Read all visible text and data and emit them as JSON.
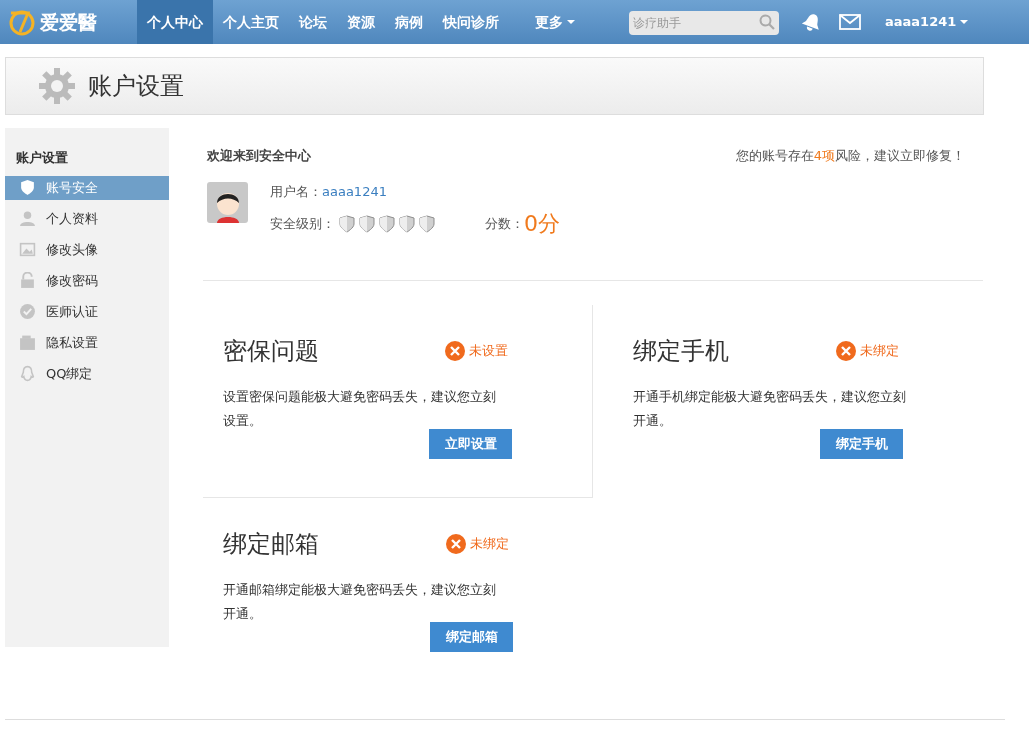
{
  "logo": {
    "text": "爱爱醫"
  },
  "nav": [
    {
      "label": "个人中心",
      "selected": true
    },
    {
      "label": "个人主页",
      "selected": false
    },
    {
      "label": "论坛",
      "selected": false
    },
    {
      "label": "资源",
      "selected": false
    },
    {
      "label": "病例",
      "selected": false
    },
    {
      "label": "快问诊所",
      "selected": false
    },
    {
      "label": "更多",
      "selected": false,
      "dropdown": true
    }
  ],
  "search": {
    "placeholder": "诊疗助手"
  },
  "user_menu": {
    "label": "aaaa1241"
  },
  "page_title": "账户设置",
  "sidebar": {
    "heading": "账户设置",
    "items": [
      {
        "label": "账号安全",
        "kind": "shield",
        "selected": true
      },
      {
        "label": "个人资料",
        "kind": "person",
        "selected": false
      },
      {
        "label": "修改头像",
        "kind": "image",
        "selected": false
      },
      {
        "label": "修改密码",
        "kind": "lock",
        "selected": false
      },
      {
        "label": "医师认证",
        "kind": "check",
        "selected": false
      },
      {
        "label": "隐私设置",
        "kind": "folder",
        "selected": false
      },
      {
        "label": "QQ绑定",
        "kind": "qq",
        "selected": false
      }
    ]
  },
  "welcome": "欢迎来到安全中心",
  "risk": {
    "prefix": "您的账号存在",
    "count": "4项",
    "suffix": "风险，建议立即修复！"
  },
  "username": {
    "label": "用户名：",
    "value": "aaaa1241"
  },
  "security_level": {
    "label": "安全级别："
  },
  "score": {
    "label": "分数：",
    "value": "0分"
  },
  "cards": [
    {
      "title": "密保问题",
      "status": "未设置",
      "description": "设置密保问题能极大避免密码丢失，建议您立刻设置。",
      "button": "立即设置"
    },
    {
      "title": "绑定手机",
      "status": "未绑定",
      "description": "开通手机绑定能极大避免密码丢失，建议您立刻开通。",
      "button": "绑定手机"
    },
    {
      "title": "绑定邮箱",
      "status": "未绑定",
      "description": "开通邮箱绑定能极大避免密码丢失，建议您立刻开通。",
      "button": "绑定邮箱"
    }
  ]
}
